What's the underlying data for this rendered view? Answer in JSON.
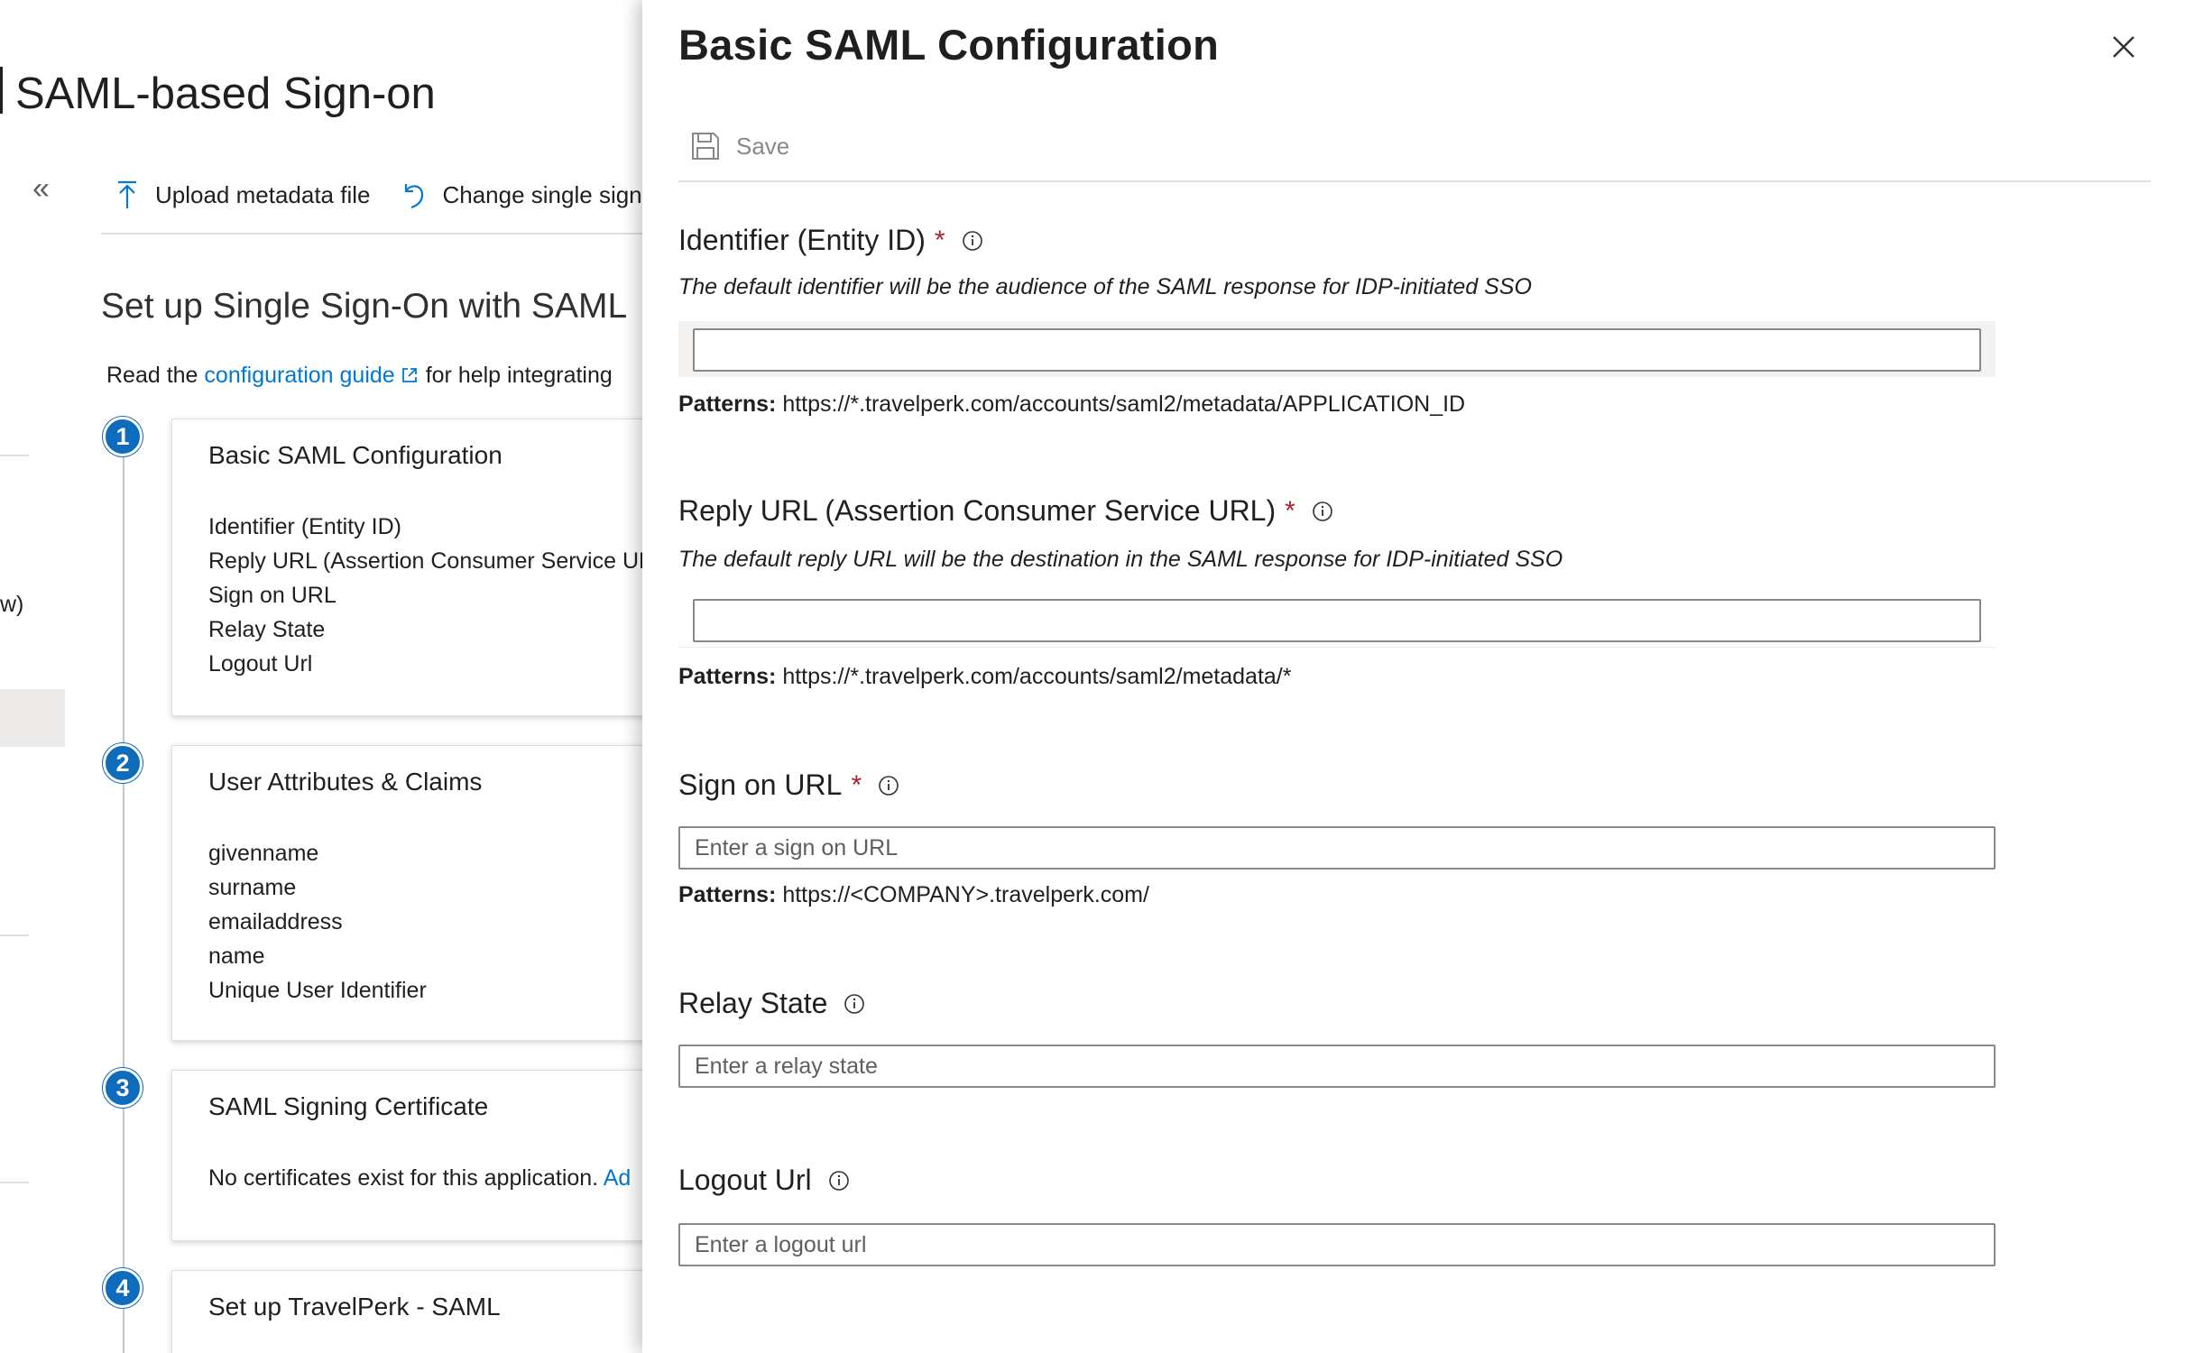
{
  "background": {
    "page_title": "SAML-based Sign-on",
    "toolbar": {
      "upload_label": "Upload metadata file",
      "change_label": "Change single sign"
    },
    "setup_title": "Set up Single Sign-On with SAML",
    "guide": {
      "prefix": "Read the",
      "link": "configuration guide",
      "suffix": "for help integrating"
    },
    "side_fragment": "w)",
    "steps": [
      {
        "number": "1",
        "title": "Basic SAML Configuration",
        "lines": [
          "Identifier (Entity ID)",
          "Reply URL (Assertion Consumer Service UR",
          "Sign on URL",
          "Relay State",
          "Logout Url"
        ]
      },
      {
        "number": "2",
        "title": "User Attributes & Claims",
        "lines": [
          "givenname",
          "surname",
          "emailaddress",
          "name",
          "Unique User Identifier"
        ]
      },
      {
        "number": "3",
        "title": "SAML Signing Certificate",
        "text": "No certificates exist for this application.",
        "link": "Ad"
      },
      {
        "number": "4",
        "title": "Set up TravelPerk - SAML"
      }
    ]
  },
  "panel": {
    "title": "Basic SAML Configuration",
    "save_label": "Save",
    "patterns_label": "Patterns:",
    "fields": {
      "identifier": {
        "label": "Identifier (Entity ID)",
        "required": "*",
        "description": "The default identifier will be the audience of the SAML response for IDP-initiated SSO",
        "value": "",
        "pattern": "https://*.travelperk.com/accounts/saml2/metadata/APPLICATION_ID"
      },
      "reply_url": {
        "label": "Reply URL (Assertion Consumer Service URL)",
        "required": "*",
        "description": "The default reply URL will be the destination in the SAML response for IDP-initiated SSO",
        "value": "",
        "pattern": "https://*.travelperk.com/accounts/saml2/metadata/*"
      },
      "sign_on_url": {
        "label": "Sign on URL",
        "required": "*",
        "placeholder": "Enter a sign on URL",
        "pattern": "https://<COMPANY>.travelperk.com/"
      },
      "relay_state": {
        "label": "Relay State",
        "placeholder": "Enter a relay state"
      },
      "logout_url": {
        "label": "Logout Url",
        "placeholder": "Enter a logout url"
      }
    }
  },
  "colors": {
    "accent": "#0078d4",
    "required": "#a4262c",
    "step_circle": "#0f6cbd"
  }
}
